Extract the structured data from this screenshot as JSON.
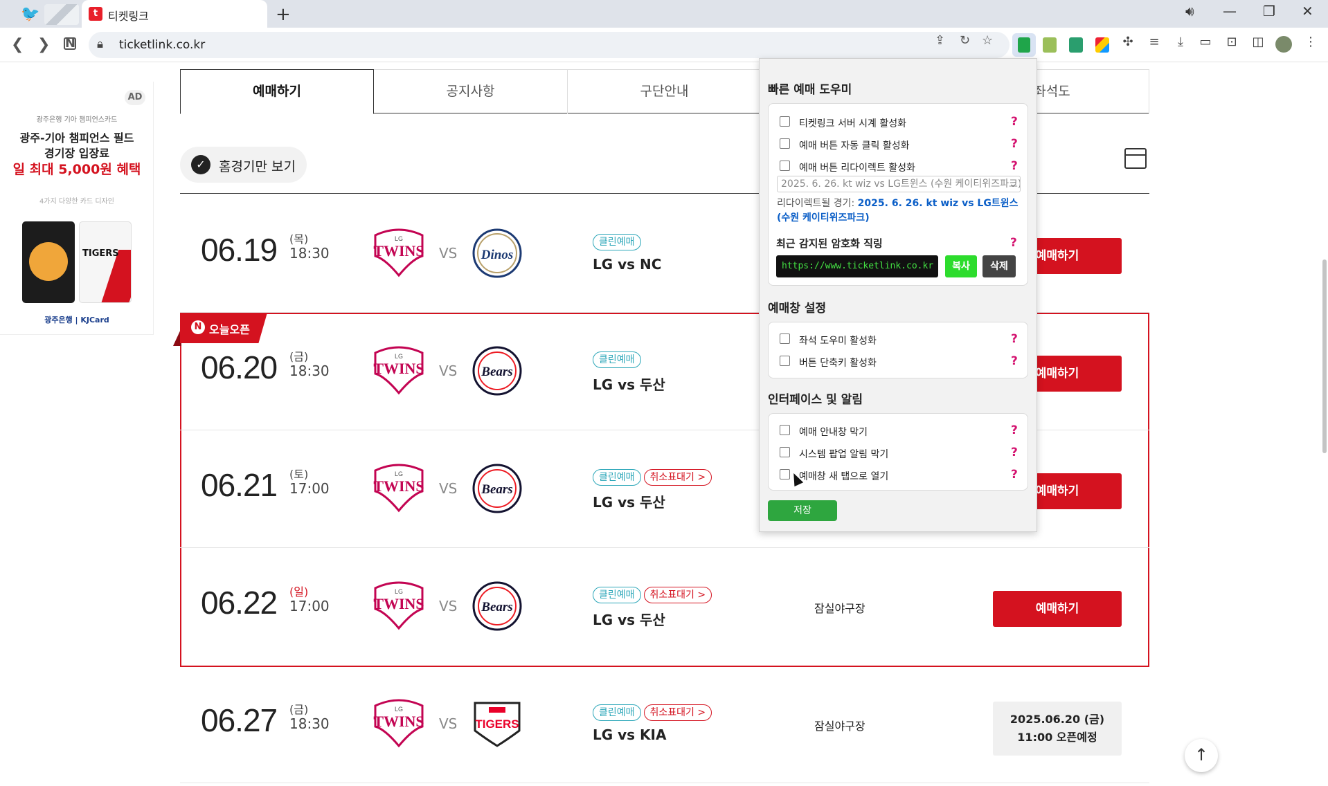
{
  "browser": {
    "tab_title": "티켓링크",
    "url": "ticketlink.co.kr"
  },
  "ad": {
    "badge": "AD",
    "line1": "광주은행 기아 챔피언스카드",
    "line2": "광주-기아 챔피언스 필드",
    "line3": "경기장 입장료",
    "line4": "일 최대 5,000원 혜택",
    "line5": "4가지 다양한 카드 디자인",
    "card_text": "TIGERS",
    "footer": "광주은행 | KJCard"
  },
  "tabs": [
    {
      "label": "예매하기"
    },
    {
      "label": "공지사항"
    },
    {
      "label": "구단안내"
    },
    {
      "label": ""
    },
    {
      "label": "좌석도"
    }
  ],
  "filter": {
    "label": "홈경기만 보기"
  },
  "open_flag": {
    "n": "N",
    "label": "오늘오픈"
  },
  "games": [
    {
      "date": "06.19",
      "day": "(목)",
      "time": "18:30",
      "vs": "VS",
      "badges": [
        "클린예매"
      ],
      "match": "LG vs NC",
      "venue": "",
      "button": "예매하기",
      "away": "NC Dinos",
      "away_color": "#1c3a73"
    },
    {
      "date": "06.20",
      "day": "(금)",
      "time": "18:30",
      "vs": "VS",
      "badges": [
        "클린예매"
      ],
      "match": "LG vs 두산",
      "venue": "",
      "button": "예매하기",
      "away": "Bears",
      "away_color": "#131230"
    },
    {
      "date": "06.21",
      "day": "(토)",
      "time": "17:00",
      "vs": "VS",
      "badges": [
        "클린예매",
        "취소표대기 >"
      ],
      "match": "LG vs 두산",
      "venue": "",
      "button": "예매하기",
      "away": "Bears",
      "away_color": "#131230"
    },
    {
      "date": "06.22",
      "day": "(일)",
      "time": "17:00",
      "vs": "VS",
      "badges": [
        "클린예매",
        "취소표대기 >"
      ],
      "match": "LG vs 두산",
      "venue": "잠실야구장",
      "button": "예매하기",
      "away": "Bears",
      "away_color": "#131230"
    },
    {
      "date": "06.27",
      "day": "(금)",
      "time": "18:30",
      "vs": "VS",
      "badges": [
        "클린예매",
        "취소표대기 >"
      ],
      "match": "LG vs KIA",
      "venue": "잠실야구장",
      "button_line1": "2025.06.20 (금)",
      "button_line2": "11:00 오픈예정",
      "away": "TIGERS",
      "away_color": "#ea0029"
    }
  ],
  "popup": {
    "section1_title": "빠른 예매 도우미",
    "section1_options": [
      "티켓링크 서버 시계 활성화",
      "예매 버튼 자동 클릭 활성화",
      "예매 버튼 리다이렉트 활성화"
    ],
    "select_value": "2025. 6. 26. kt wiz vs LG트윈스 (수원 케이티위즈파크)",
    "redirect_label": "리다이렉트될 경기:",
    "redirect_value": "2025. 6. 26. kt wiz vs LG트윈스 (수원 케이티위즈파크)",
    "sniper_title": "최근 감지된 암호화 직링",
    "sniper_url": "https://www.ticketlink.co.kr",
    "copy": "복사",
    "delete": "삭제",
    "section2_title": "예매창 설정",
    "section2_options": [
      "좌석 도우미 활성화",
      "버튼 단축키 활성화"
    ],
    "section3_title": "인터페이스 및 알림",
    "section3_options": [
      "예매 안내창 막기",
      "시스템 팝업 알림 막기",
      "예매창 새 탭으로 열기"
    ],
    "help": "?",
    "save": "저장"
  },
  "team_logo": {
    "home": "TWINS",
    "home_top": "LG",
    "home_color": "#c30452"
  },
  "colors": {
    "accent": "#d4121f",
    "clean_badge": "#2aa6b8",
    "extension_green": "#2ea63f"
  }
}
